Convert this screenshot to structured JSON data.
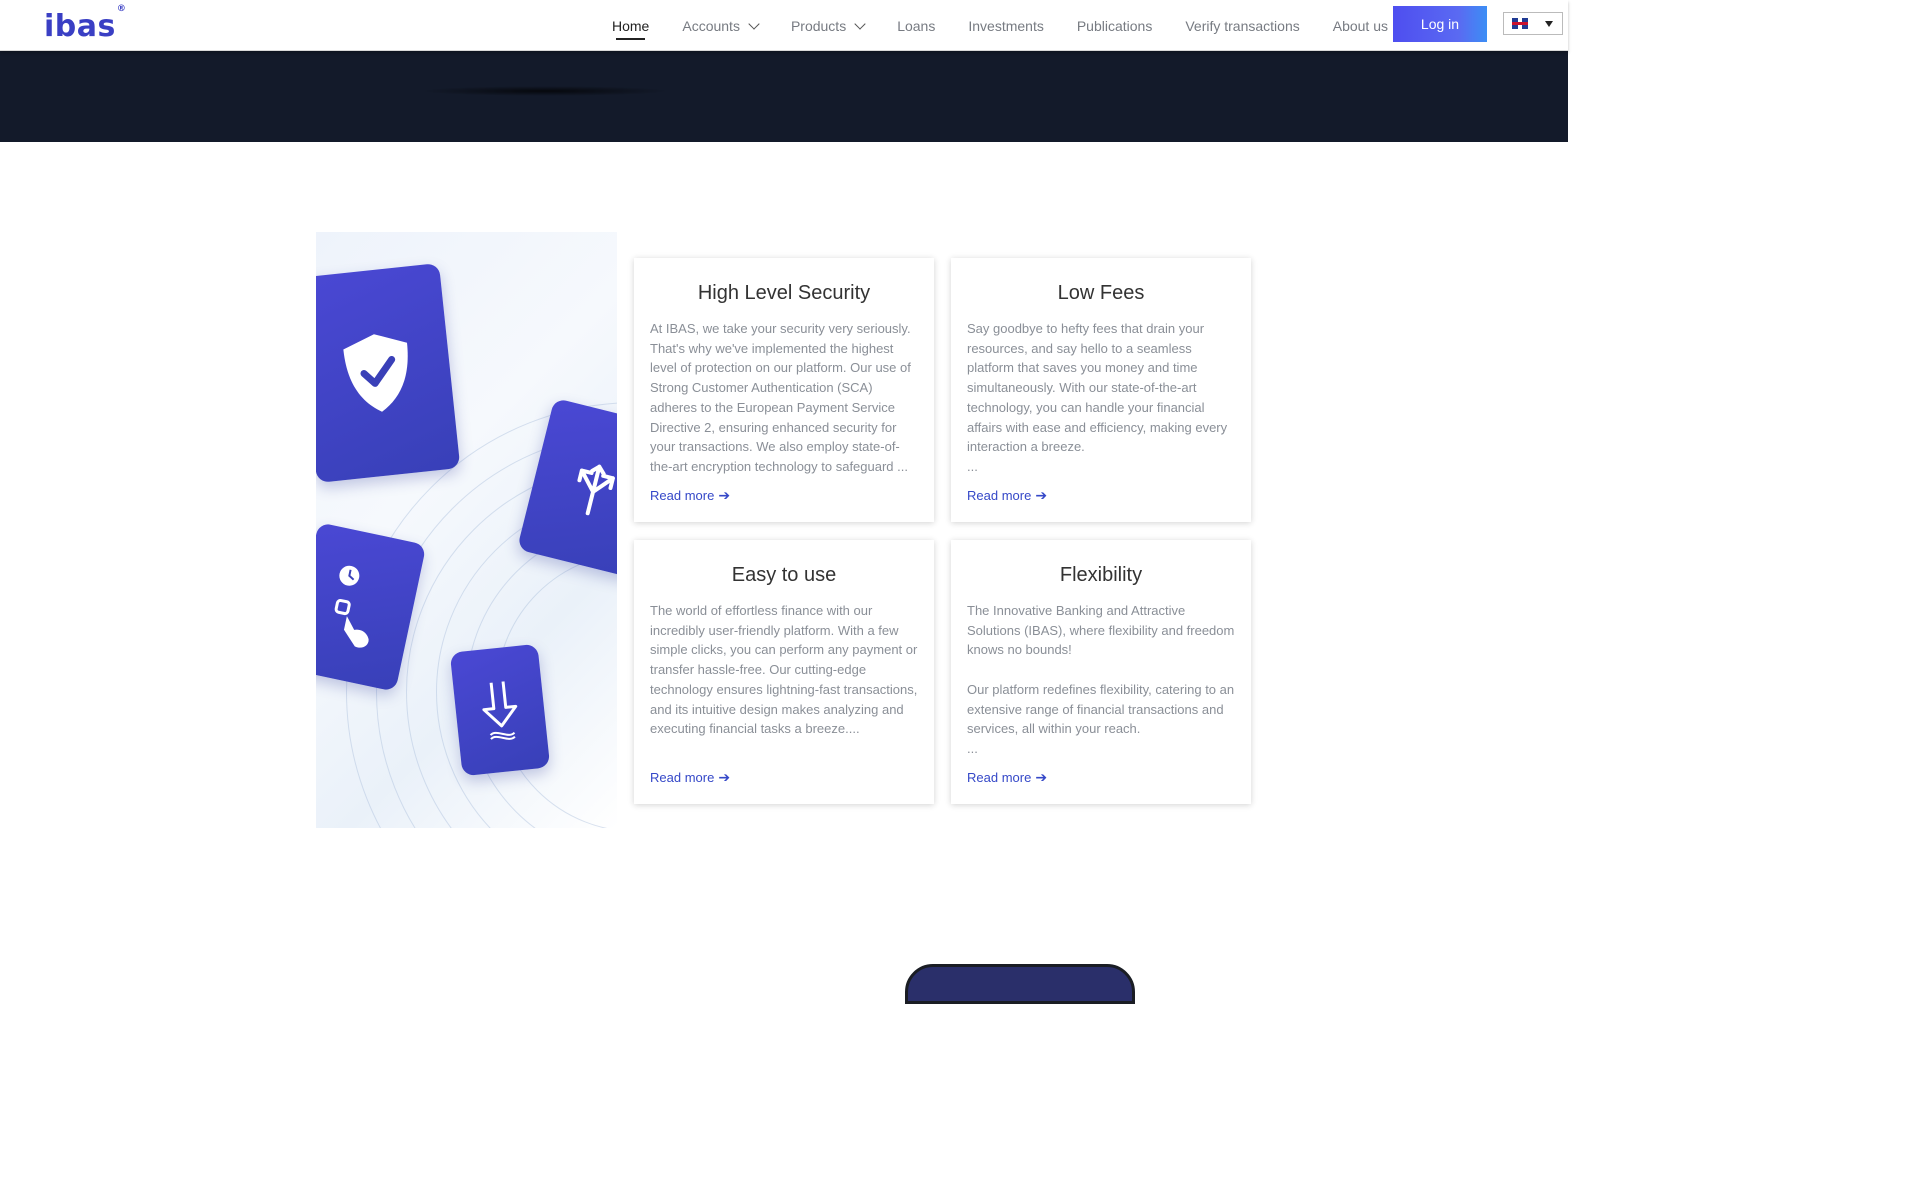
{
  "header": {
    "logo": "ibas",
    "logo_mark": "®",
    "nav": [
      {
        "label": "Home",
        "active": true,
        "dropdown": false
      },
      {
        "label": "Accounts",
        "active": false,
        "dropdown": true
      },
      {
        "label": "Products",
        "active": false,
        "dropdown": true
      },
      {
        "label": "Loans",
        "active": false,
        "dropdown": false
      },
      {
        "label": "Investments",
        "active": false,
        "dropdown": false
      },
      {
        "label": "Publications",
        "active": false,
        "dropdown": false
      },
      {
        "label": "Verify transactions",
        "active": false,
        "dropdown": false
      },
      {
        "label": "About us",
        "active": false,
        "dropdown": true
      }
    ],
    "login_label": "Log in",
    "language_flag": "uk-flag-icon"
  },
  "colors": {
    "brand": "#3a3fc4",
    "hero_bg": "#131a2a",
    "link": "#3548c8",
    "card_icon_bg": "#4046c6"
  },
  "illustration": {
    "icons": [
      "shield-check-icon",
      "split-arrows-icon",
      "tap-clock-icon",
      "download-icon"
    ]
  },
  "features": [
    {
      "title": "High Level Security",
      "paragraphs": [
        "At IBAS, we take your security very seriously. That's why we've implemented the highest level of protection on our platform. Our use of Strong Customer Authentication (SCA) adheres to the European Payment Service Directive 2, ensuring enhanced security for your transactions. We also employ state-of-the-art encryption technology to safeguard ..."
      ],
      "read_more": "Read more"
    },
    {
      "title": "Low Fees",
      "paragraphs": [
        "Say goodbye to hefty fees that drain your resources, and say hello to a seamless platform that saves you money and time simultaneously. With our state-of-the-art technology, you can handle your financial affairs with ease and efficiency, making every interaction a breeze.",
        "..."
      ],
      "read_more": "Read more"
    },
    {
      "title": "Easy to use",
      "paragraphs": [
        "The world of effortless finance with our incredibly user-friendly platform. With a few simple clicks, you can perform any payment or transfer hassle-free. Our cutting-edge technology ensures lightning-fast transactions, and its intuitive design makes analyzing and executing financial tasks a breeze...."
      ],
      "read_more": "Read more"
    },
    {
      "title": "Flexibility",
      "paragraphs": [
        "The Innovative Banking and Attractive Solutions (IBAS), where flexibility and freedom knows no bounds!",
        "",
        "Our platform redefines flexibility, catering to an extensive range of financial transactions and services, all within your reach.",
        "..."
      ],
      "read_more": "Read more"
    }
  ]
}
